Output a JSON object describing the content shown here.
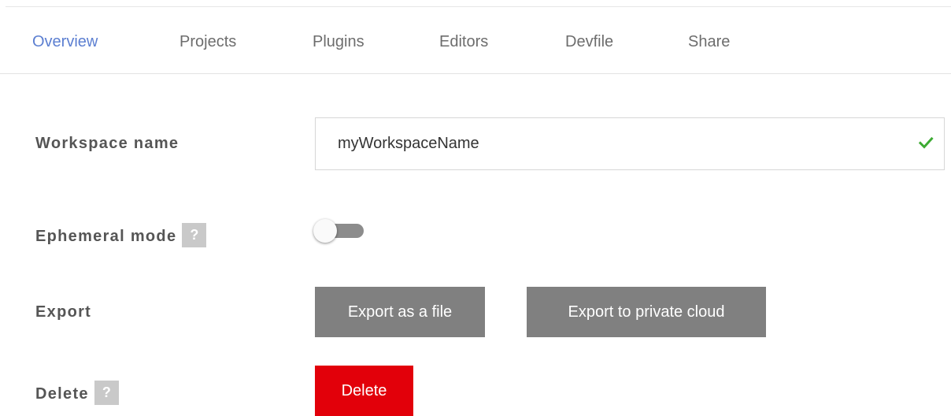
{
  "tabs": [
    {
      "label": "Overview",
      "active": true
    },
    {
      "label": "Projects"
    },
    {
      "label": "Plugins"
    },
    {
      "label": "Editors"
    },
    {
      "label": "Devfile"
    },
    {
      "label": "Share"
    }
  ],
  "workspace_name": {
    "label": "Workspace name",
    "value": "myWorkspaceName",
    "valid": true,
    "check_color": "#3dab33"
  },
  "ephemeral_mode": {
    "label": "Ephemeral mode",
    "help": "?",
    "enabled": false
  },
  "export": {
    "label": "Export",
    "file_button": "Export as a file",
    "cloud_button": "Export to private cloud"
  },
  "delete": {
    "label": "Delete",
    "help": "?",
    "button": "Delete"
  },
  "colors": {
    "accent": "#5c7fd1",
    "danger": "#e2000a",
    "neutral_button": "#808080"
  }
}
